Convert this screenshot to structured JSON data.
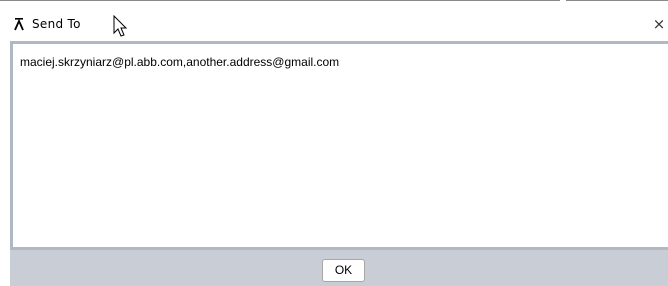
{
  "window": {
    "title": "Send To",
    "icon": "app-lambda-icon",
    "close_glyph": "×"
  },
  "message": {
    "recipients_text": "maciej.skrzyniarz@pl.abb.com,another.address@gmail.com"
  },
  "footer": {
    "ok_label": "OK"
  },
  "colors": {
    "frame": "#b0b8c4",
    "footer_bg": "#c9ced6",
    "button_border": "#a7a7a7"
  }
}
